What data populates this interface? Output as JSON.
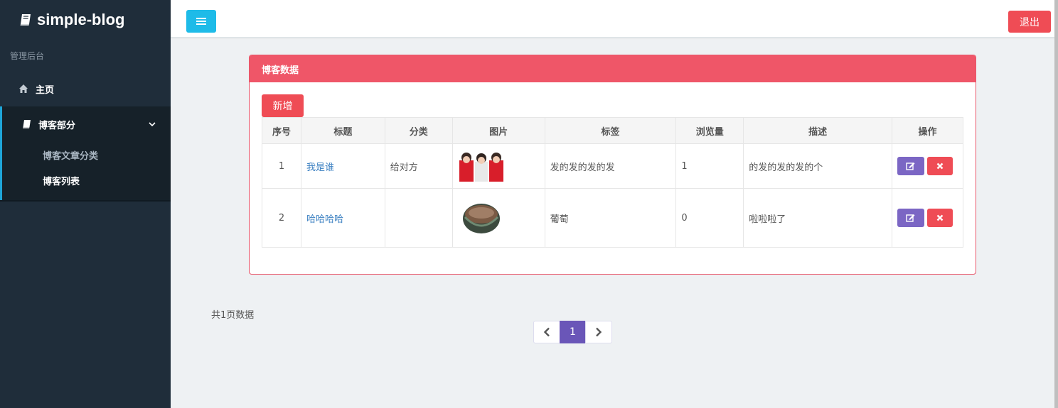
{
  "brand": {
    "name": "simple-blog"
  },
  "sidebar": {
    "section_label": "管理后台",
    "home": "主页",
    "group": {
      "label": "博客部分",
      "items": [
        {
          "label": "博客文章分类"
        },
        {
          "label": "博客列表"
        }
      ]
    }
  },
  "topbar": {
    "logout_label": "退出"
  },
  "panel": {
    "title": "博客数据",
    "add_label": "新增",
    "columns": [
      "序号",
      "标题",
      "分类",
      "图片",
      "标签",
      "浏览量",
      "描述",
      "操作"
    ],
    "rows": [
      {
        "index": "1",
        "title": "我是谁",
        "category": "给对方",
        "tags": "发的发的发的发",
        "views": "1",
        "desc": "的发的发的发的个"
      },
      {
        "index": "2",
        "title": "哈哈哈哈",
        "category": "",
        "tags": "葡萄",
        "views": "0",
        "desc": "啦啦啦了"
      }
    ]
  },
  "pagination": {
    "info": "共1页数据",
    "current": "1"
  },
  "colors": {
    "accent": "#ef5668",
    "info": "#1ebbe8",
    "purple": "#7b66c4",
    "sidebar": "#1f2d3a"
  }
}
